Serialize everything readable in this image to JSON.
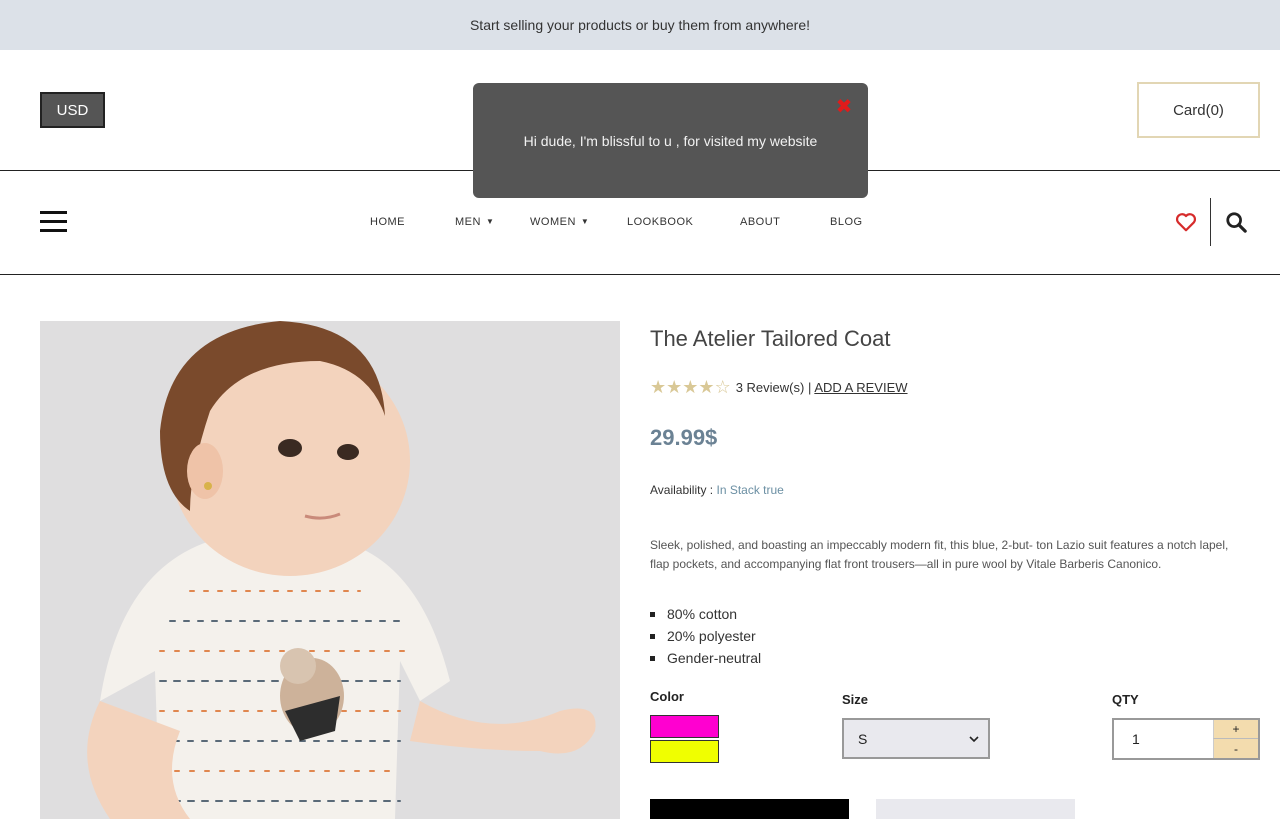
{
  "announcement": "Start selling your products or buy them from anywhere!",
  "header": {
    "currency_label": "USD",
    "cart_label": "Card(0)"
  },
  "toast": {
    "message": "Hi dude, I'm blissful to u , for visited my website",
    "close_glyph": "✖"
  },
  "nav": {
    "items": [
      {
        "label": "HOME",
        "has_dropdown": false
      },
      {
        "label": "MEN",
        "has_dropdown": true
      },
      {
        "label": "WOMEN",
        "has_dropdown": true
      },
      {
        "label": "LOOKBOOK",
        "has_dropdown": false
      },
      {
        "label": "ABOUT",
        "has_dropdown": false
      },
      {
        "label": "BLOG",
        "has_dropdown": false
      }
    ],
    "icons": [
      "menu-icon",
      "heart-icon",
      "search-icon"
    ]
  },
  "product": {
    "title": "The Atelier Tailored Coat",
    "rating": 4,
    "rating_max": 5,
    "reviews_text": "3 Review(s) |",
    "add_review_label": "ADD A REVIEW",
    "price": "29.99$",
    "availability_label": "Availability :",
    "availability_value": "In Stack true",
    "description": "Sleek, polished, and boasting an impeccably modern fit, this blue, 2-but- ton Lazio suit features a notch lapel, flap pockets, and accompanying flat front trousers—all in pure wool by Vitale Barberis Canonico.",
    "features": [
      "80% cotton",
      "20% polyester",
      "Gender-neutral"
    ],
    "color_label": "Color",
    "colors": [
      "#ff00d0",
      "#f0ff00"
    ],
    "size_label": "Size",
    "size_value": "S",
    "qty_label": "QTY",
    "qty_value": "1",
    "qty_plus": "+",
    "qty_minus": "-"
  },
  "colors": {
    "topbar_bg": "#dce1e8",
    "toast_bg": "#555555",
    "price": "#6b8294",
    "accent_heart": "#d62b2b",
    "qty_button_bg": "#f3dcae"
  }
}
